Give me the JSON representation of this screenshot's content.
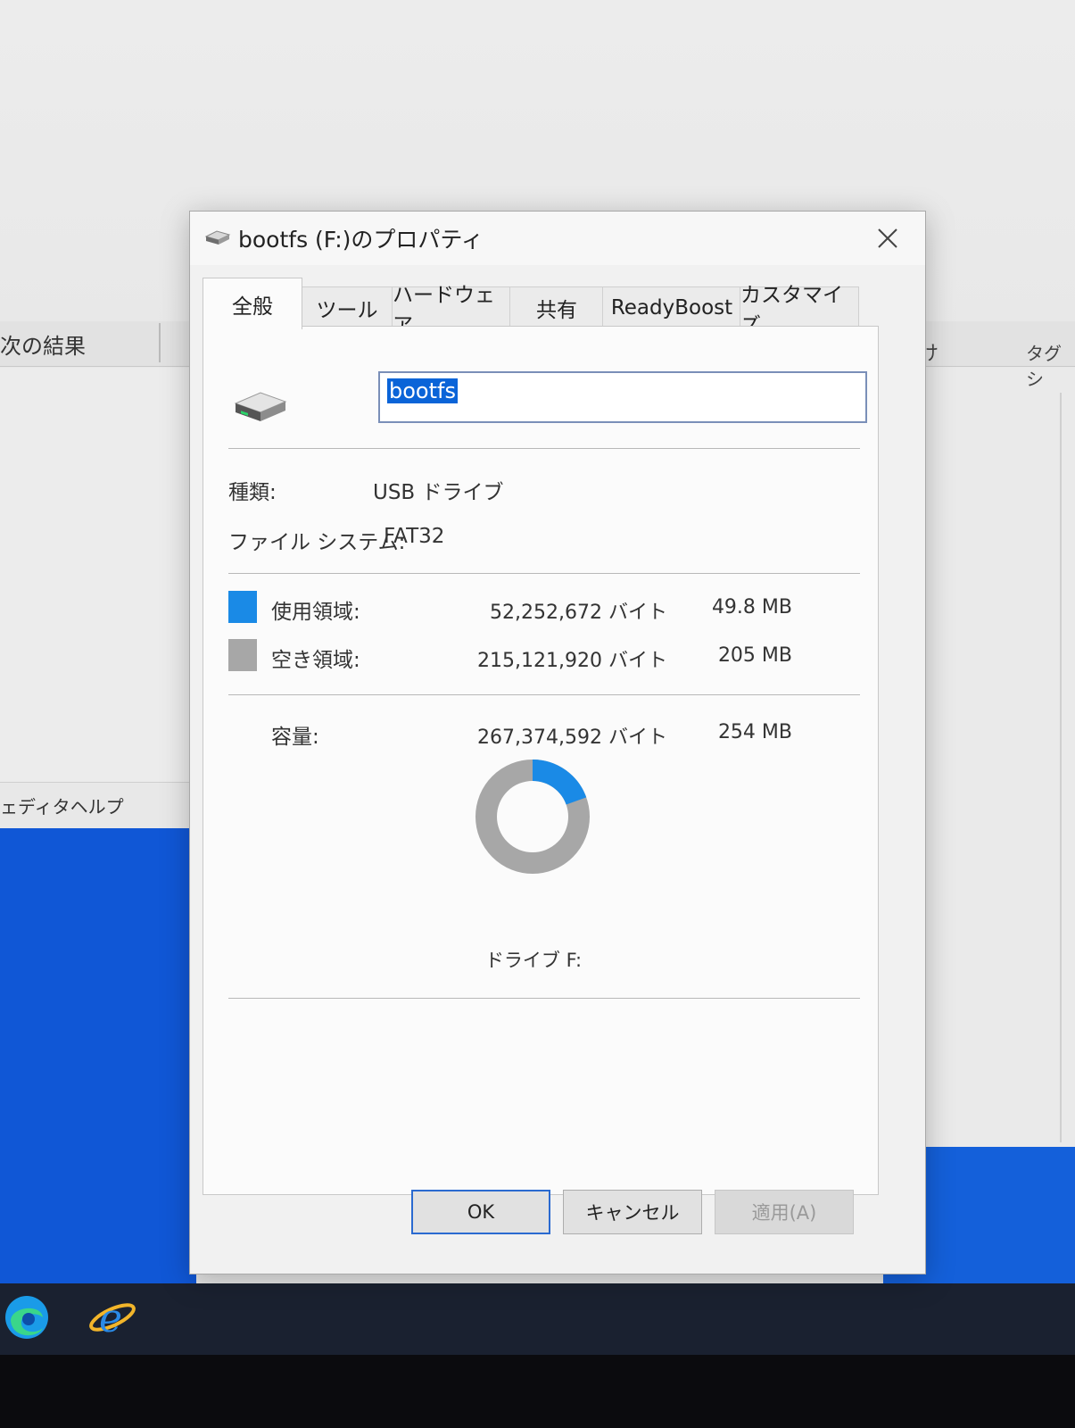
{
  "background": {
    "ribbon_left_text": "次の結果",
    "ribbon_right_text_1": "け",
    "ribbon_right_text_2": "タグ シ",
    "status_text": "ェディタヘルプ"
  },
  "dialog": {
    "title": "bootfs (F:)のプロパティ",
    "tabs": [
      {
        "label": "全般",
        "active": true
      },
      {
        "label": "ツール"
      },
      {
        "label": "ハードウェア"
      },
      {
        "label": "共有"
      },
      {
        "label": "ReadyBoost"
      },
      {
        "label": "カスタマイズ"
      }
    ],
    "volume_name": "bootfs",
    "type_label": "種類:",
    "type_value": "USB ドライブ",
    "fs_label": "ファイル システム:",
    "fs_value": "FAT32",
    "used_label": "使用領域:",
    "used_bytes": "52,252,672 バイト",
    "used_size": "49.8 MB",
    "free_label": "空き領域:",
    "free_bytes": "215,121,920 バイト",
    "free_size": "205 MB",
    "capacity_label": "容量:",
    "capacity_bytes": "267,374,592 バイト",
    "capacity_size": "254 MB",
    "drive_label": "ドライブ F:",
    "used_fraction": 0.195,
    "colors": {
      "used": "#1a8ae6",
      "free": "#a7a7a7"
    },
    "buttons": {
      "ok": "OK",
      "cancel": "キャンセル",
      "apply": "適用(A)"
    }
  },
  "taskbar": {
    "icons": [
      "edge-icon",
      "internet-explorer-icon"
    ]
  }
}
